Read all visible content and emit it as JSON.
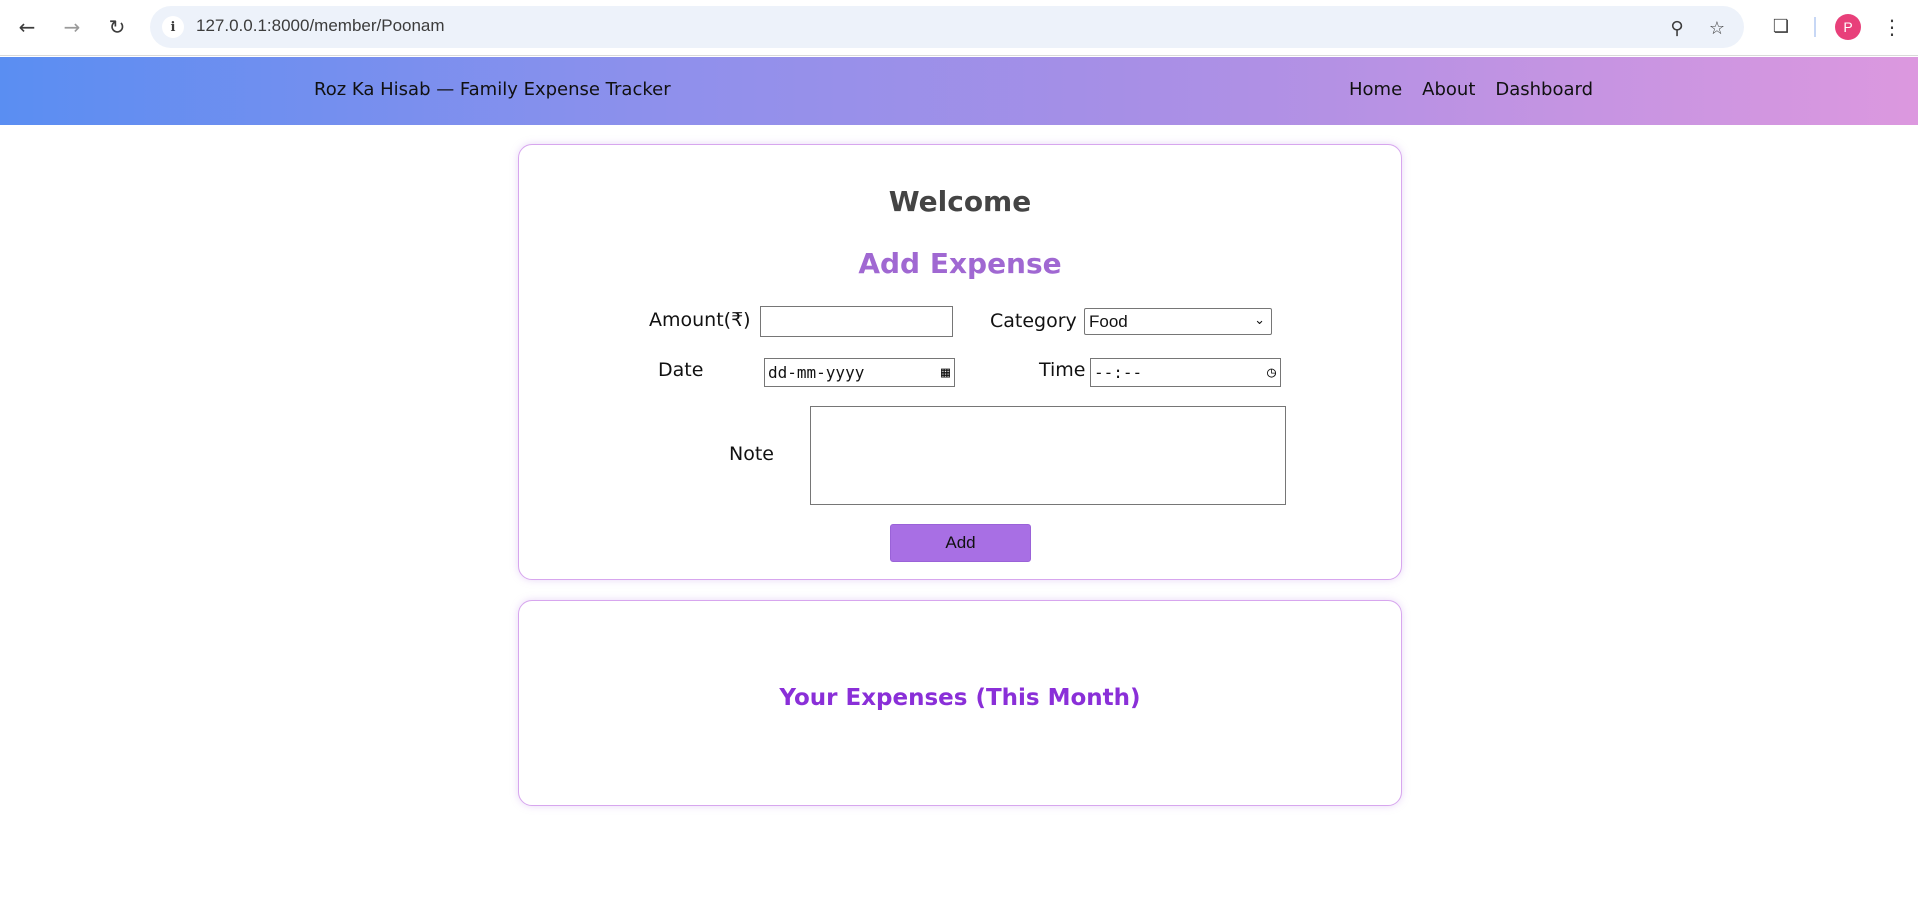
{
  "browser": {
    "url": "127.0.0.1:8000/member/Poonam",
    "profile_initial": "P",
    "icons": {
      "back": "arrow-left-icon",
      "forward": "arrow-right-icon",
      "reload": "reload-icon",
      "site_info": "info-icon",
      "zoom": "zoom-icon",
      "bookmark": "star-icon",
      "extensions": "puzzle-icon",
      "menu": "more-vertical-icon"
    }
  },
  "header": {
    "brand": "Roz Ka Hisab — Family Expense Tracker",
    "nav": [
      "Home",
      "About",
      "Dashboard"
    ],
    "gradient": [
      "#5a8ef2",
      "#a88fe6",
      "#dc98df"
    ]
  },
  "add_card": {
    "welcome": "Welcome",
    "title": "Add Expense",
    "amount_label": "Amount(₹)",
    "amount_value": "",
    "category_label": "Category",
    "category_value": "Food",
    "date_label": "Date",
    "date_placeholder": "dd-mm-yyyy",
    "time_label": "Time",
    "time_placeholder": "--:--",
    "note_label": "Note",
    "note_value": "",
    "add_button": "Add"
  },
  "list_card": {
    "title": "Your Expenses (This Month)"
  },
  "colors": {
    "accent": "#a86fe4",
    "title_purple": "#8a2fd8",
    "card_border": "#d7a6ee"
  }
}
